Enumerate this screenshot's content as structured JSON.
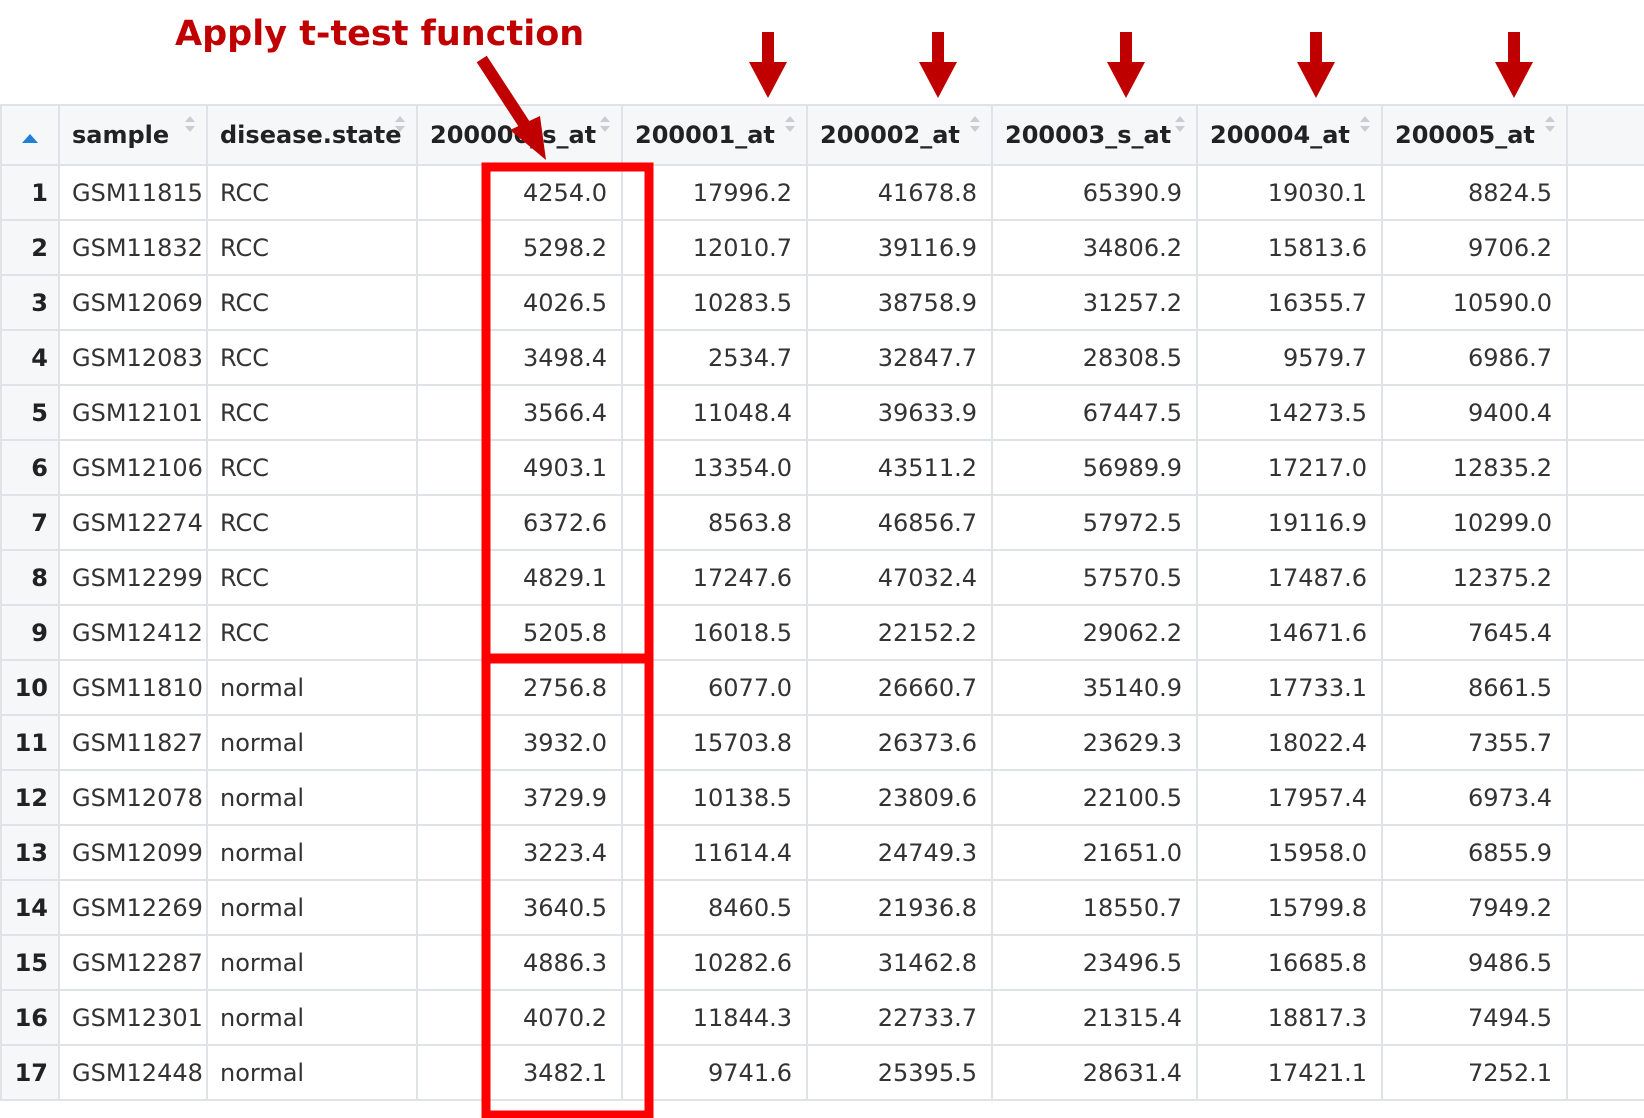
{
  "annotation": {
    "title": "Apply t-test function",
    "color": "#c00000",
    "highlight_color": "#ff0000"
  },
  "table": {
    "index_header_icon": "sort-ascending-icon",
    "columns": [
      "sample",
      "disease.state",
      "200000_s_at",
      "200001_at",
      "200002_at",
      "200003_s_at",
      "200004_at",
      "200005_at"
    ],
    "rows": [
      {
        "index": "1",
        "sample": "GSM11815",
        "disease_state": "RCC",
        "values": [
          "4254.0",
          "17996.2",
          "41678.8",
          "65390.9",
          "19030.1",
          "8824.5"
        ]
      },
      {
        "index": "2",
        "sample": "GSM11832",
        "disease_state": "RCC",
        "values": [
          "5298.2",
          "12010.7",
          "39116.9",
          "34806.2",
          "15813.6",
          "9706.2"
        ]
      },
      {
        "index": "3",
        "sample": "GSM12069",
        "disease_state": "RCC",
        "values": [
          "4026.5",
          "10283.5",
          "38758.9",
          "31257.2",
          "16355.7",
          "10590.0"
        ]
      },
      {
        "index": "4",
        "sample": "GSM12083",
        "disease_state": "RCC",
        "values": [
          "3498.4",
          "2534.7",
          "32847.7",
          "28308.5",
          "9579.7",
          "6986.7"
        ]
      },
      {
        "index": "5",
        "sample": "GSM12101",
        "disease_state": "RCC",
        "values": [
          "3566.4",
          "11048.4",
          "39633.9",
          "67447.5",
          "14273.5",
          "9400.4"
        ]
      },
      {
        "index": "6",
        "sample": "GSM12106",
        "disease_state": "RCC",
        "values": [
          "4903.1",
          "13354.0",
          "43511.2",
          "56989.9",
          "17217.0",
          "12835.2"
        ]
      },
      {
        "index": "7",
        "sample": "GSM12274",
        "disease_state": "RCC",
        "values": [
          "6372.6",
          "8563.8",
          "46856.7",
          "57972.5",
          "19116.9",
          "10299.0"
        ]
      },
      {
        "index": "8",
        "sample": "GSM12299",
        "disease_state": "RCC",
        "values": [
          "4829.1",
          "17247.6",
          "47032.4",
          "57570.5",
          "17487.6",
          "12375.2"
        ]
      },
      {
        "index": "9",
        "sample": "GSM12412",
        "disease_state": "RCC",
        "values": [
          "5205.8",
          "16018.5",
          "22152.2",
          "29062.2",
          "14671.6",
          "7645.4"
        ]
      },
      {
        "index": "10",
        "sample": "GSM11810",
        "disease_state": "normal",
        "values": [
          "2756.8",
          "6077.0",
          "26660.7",
          "35140.9",
          "17733.1",
          "8661.5"
        ]
      },
      {
        "index": "11",
        "sample": "GSM11827",
        "disease_state": "normal",
        "values": [
          "3932.0",
          "15703.8",
          "26373.6",
          "23629.3",
          "18022.4",
          "7355.7"
        ]
      },
      {
        "index": "12",
        "sample": "GSM12078",
        "disease_state": "normal",
        "values": [
          "3729.9",
          "10138.5",
          "23809.6",
          "22100.5",
          "17957.4",
          "6973.4"
        ]
      },
      {
        "index": "13",
        "sample": "GSM12099",
        "disease_state": "normal",
        "values": [
          "3223.4",
          "11614.4",
          "24749.3",
          "21651.0",
          "15958.0",
          "6855.9"
        ]
      },
      {
        "index": "14",
        "sample": "GSM12269",
        "disease_state": "normal",
        "values": [
          "3640.5",
          "8460.5",
          "21936.8",
          "18550.7",
          "15799.8",
          "7949.2"
        ]
      },
      {
        "index": "15",
        "sample": "GSM12287",
        "disease_state": "normal",
        "values": [
          "4886.3",
          "10282.6",
          "31462.8",
          "23496.5",
          "16685.8",
          "9486.5"
        ]
      },
      {
        "index": "16",
        "sample": "GSM12301",
        "disease_state": "normal",
        "values": [
          "4070.2",
          "11844.3",
          "22733.7",
          "21315.4",
          "18817.3",
          "7494.5"
        ]
      },
      {
        "index": "17",
        "sample": "GSM12448",
        "disease_state": "normal",
        "values": [
          "3482.1",
          "9741.6",
          "25395.5",
          "28631.4",
          "17421.1",
          "7252.1"
        ]
      }
    ]
  }
}
